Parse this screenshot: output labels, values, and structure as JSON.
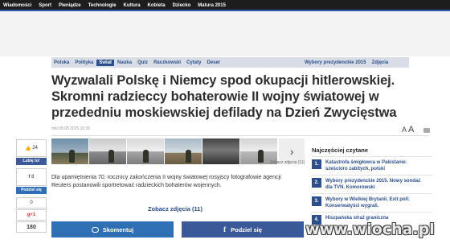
{
  "topnav": [
    "Wiadomości",
    "Sport",
    "Pieniądze",
    "Technologie",
    "Kultura",
    "Kobieta",
    "Dziecko",
    "Matura 2015"
  ],
  "section_nav": [
    "Polska",
    "Polityka",
    "Świat",
    "Nauka",
    "Quiz",
    "Raczkowski",
    "Cytaty",
    "Deser",
    "Wybory prezydenckie 2015",
    "Zdjęcia"
  ],
  "section_nav_active": "Świat",
  "article": {
    "headline": "Wyzwalali Polskę i Niemcy spod okupacji hitlerowskiej. Skromni radzieccy bohaterowie II wojny światowej w przededniu moskiewskiej defilady na Dzień Zwycięstwa",
    "author": "mkl",
    "date": "08.05.2015 10:35",
    "font_small": "A",
    "font_big": "A",
    "lead": "Dla upamiętnienia 70. rocznicy zakończenia II wojny światowej rosyjscy fotografowie agencji Reuters postanowili sportretować radzieckich bohaterów wojennych.",
    "gallery_link": "Zobacz zdjęcia (11)",
    "gallery_count": "Zobacz zdjęcia (11)"
  },
  "social": {
    "likes": "24",
    "like_btn": "Lubię to!",
    "shares": "8",
    "share_btn": "Podziel się",
    "gplus_count": "0",
    "gplus": "g+1",
    "comments": "180"
  },
  "buttons": {
    "comment": "Skomentuj",
    "share": "Podziel się"
  },
  "sidebar": {
    "heading": "Najczęściej czytane",
    "items": [
      {
        "num": "1.",
        "text": "Katastrofa śmigłowca w Pakistanie: sześcioro zabitych, polski"
      },
      {
        "num": "2.",
        "text": "Wybory prezydenckie 2015. Nowy sondaż dla TVN. Komorowski"
      },
      {
        "num": "3.",
        "text": "Wybory w Wielkiej Brytanii. Exit poll: Konserwatyści wygrali."
      },
      {
        "num": "4.",
        "text": "Hiszpańska straż graniczna"
      }
    ]
  },
  "watermark": "www.wiocha.pl",
  "colors": {
    "brand_blue": "#2b4f8c",
    "facebook": "#3b5998",
    "topbar": "#1d1d1d"
  }
}
